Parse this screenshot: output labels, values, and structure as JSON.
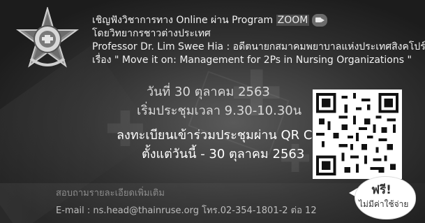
{
  "invite": {
    "line1_prefix": "เชิญฟังวิชาการทาง Online ผ่าน Program ",
    "line1_zoom": "ZOOM",
    "line2": "โดยวิทยากรชาวต่างประเทศ",
    "line3": "Professor Dr. Lim Swee Hia : อดีตนายกสมาคมพยาบาลแห่งประเทศสิงคโปร์",
    "line4": "เรื่อง \" Move it on: Management for 2Ps in Nursing Organizations \""
  },
  "schedule": {
    "date": "วันที่ 30 ตุลาคม 2563",
    "time": "เริ่มประชุมเวลา 9.30-10.30น"
  },
  "registration": {
    "line1": "ลงทะเบียนเข้าร่วมประชุมผ่าน QR Code ได้",
    "line2": "ตั้งแต่วันนี้ - 30 ตุลาคม 2563"
  },
  "contact": {
    "title": "สอบถามรายละเอียดเพิ่มเติม",
    "email_line": "E-mail : ns.head@thainruse.org โทร.02-354-1801-2 ต่อ 12"
  },
  "badge": {
    "line1": "ฟรี!",
    "line2": "ไม่มีค่าใช้จ่าย"
  },
  "icons": {
    "logo": "nurses-association-emblem-icon",
    "zoom": "zoom-camera-icon",
    "qr": "qr-code-icon"
  }
}
